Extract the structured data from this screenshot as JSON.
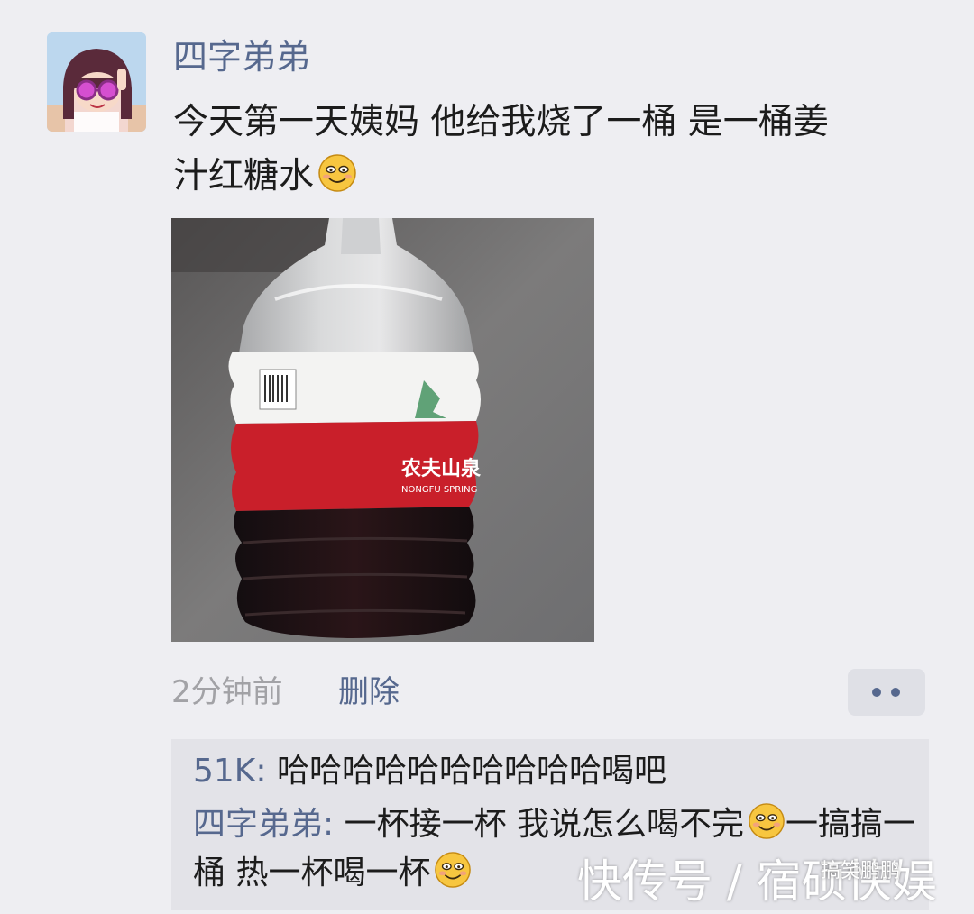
{
  "post": {
    "username": "四字弟弟",
    "text_line1": "今天第一天姨妈 他给我烧了一桶 是一桶姜",
    "text_line2": "汁红糖水",
    "timestamp": "2分钟前",
    "delete_label": "删除",
    "photo": {
      "bottle_brand": "农夫山泉",
      "bottle_brand_latin": "NONGFU SPRING"
    }
  },
  "comments": [
    {
      "author": "51K:",
      "text": " 哈哈哈哈哈哈哈哈哈哈喝吧"
    },
    {
      "author": "四字弟弟:",
      "text_part1": " 一杯接一杯 我说怎么喝不完",
      "text_part2": "一搞搞一桶 热一杯喝一杯"
    }
  ],
  "watermark": {
    "platform": "快传号 / 宿硕快娱",
    "channel": "搞笑鹏鹏"
  },
  "icons": {
    "emoji": "smile-emoji-icon",
    "more": "more-dots-icon",
    "avatar": "cartoon-girl-avatar"
  },
  "colors": {
    "background": "#eeeef2",
    "link_blue": "#56688e",
    "comment_bg": "#e3e3e8",
    "text": "#1c1c1c",
    "muted": "#a2a2a6"
  }
}
